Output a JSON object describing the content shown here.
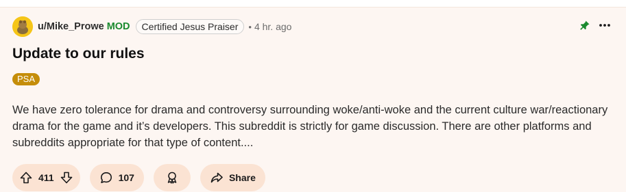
{
  "post": {
    "author": "u/Mike_Prowe",
    "mod_label": "MOD",
    "user_flair": "Certified Jesus Praiser",
    "separator": "•",
    "time": "4 hr. ago",
    "title": "Update to our rules",
    "post_flair": "PSA",
    "body": "We have zero tolerance for drama and controversy surrounding woke/anti-woke and the current culture war/reactionary drama for the game and it’s developers. This subreddit is strictly for game discussion. There are other platforms and subreddits appropriate for that type of content....",
    "votes": "411",
    "comments": "107",
    "share_label": "Share"
  },
  "colors": {
    "background": "#fdf6f2",
    "mod_green": "#1a8a2e",
    "psa_flair": "#c58d0a",
    "action_pill": "#fbe3d3"
  },
  "icons": [
    "pin-icon",
    "more-options-icon",
    "upvote-icon",
    "downvote-icon",
    "comment-icon",
    "award-icon",
    "share-icon"
  ]
}
